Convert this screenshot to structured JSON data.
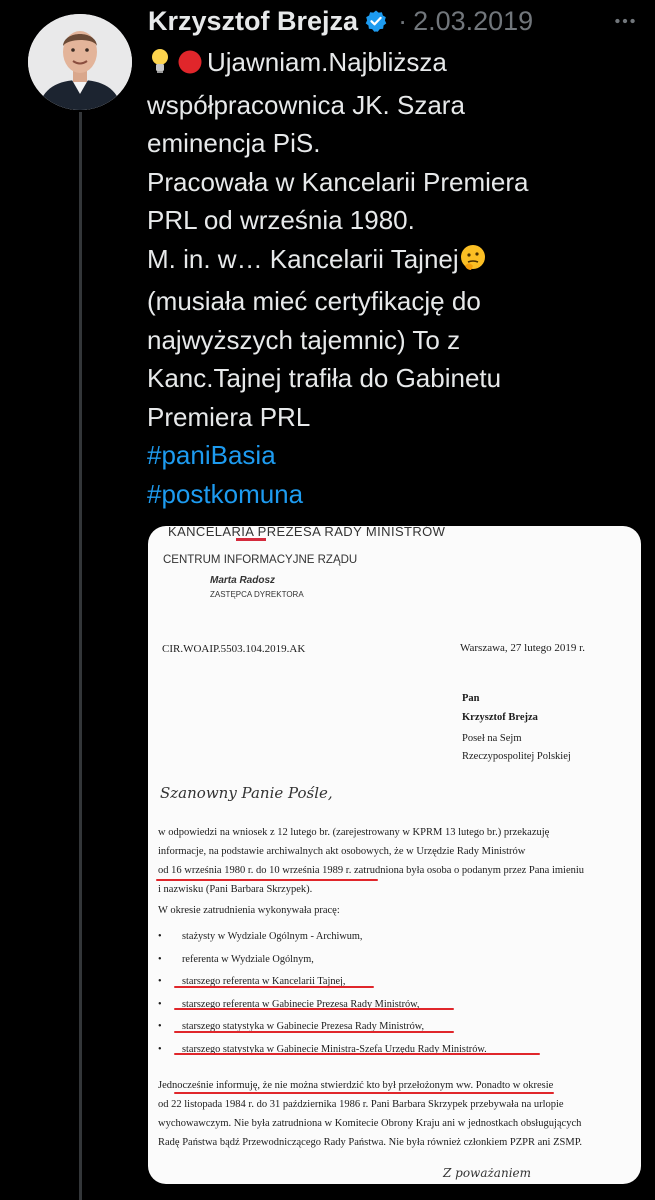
{
  "tweet": {
    "author": "Krzysztof Brejza",
    "separator": "·",
    "date": "2.03.2019",
    "text_lines": [
      {
        "emoji": [
          "lightbulb",
          "red-circle"
        ],
        "text": "Ujawniam.Najbliższa"
      },
      {
        "text": "współpracownica JK. Szara"
      },
      {
        "text": "eminencja PiS."
      },
      {
        "text": "Pracowała w Kancelarii Premiera"
      },
      {
        "text": "PRL od września 1980."
      },
      {
        "text": "M. in. w… Kancelarii Tajnej",
        "emoji_after": "thinking-face"
      },
      {
        "text": "(musiała mieć certyfikację do"
      },
      {
        "text": "najwyższych tajemnic) To z"
      },
      {
        "text": "Kanc.Tajnej trafiła do Gabinetu"
      },
      {
        "text": "Premiera PRL"
      }
    ],
    "hashtags": [
      "#paniBasia",
      "#postkomuna"
    ],
    "colors": {
      "hashtag": "#1d9bf0",
      "verified": "#1d9bf0",
      "underline": "#e0262b"
    }
  },
  "document": {
    "org": "KANCELARIA PREZESA RADY MINISTRÓW",
    "dept": "CENTRUM INFORMACYJNE RZĄDU",
    "signer_name": "Marta Radosz",
    "signer_role": "ZASTĘPCA DYREKTORA",
    "ref": "CIR.WOAIP.5503.104.2019.AK",
    "place_date": "Warszawa, 27 lutego 2019 r.",
    "addressee": [
      "Pan",
      "Krzysztof Brejza",
      "Poseł na Sejm",
      "Rzeczypospolitej Polskiej"
    ],
    "greeting": "Szanowny Panie Pośle,",
    "para1": [
      "w odpowiedzi na wniosek z 12 lutego br. (zarejestrowany w KPRM 13 lutego br.) przekazuję",
      "informacje, na podstawie archiwalnych akt osobowych, że w Urzędzie Rady Ministrów",
      "od 16 września 1980 r. do 10 września 1989 r. zatrudniona była osoba o podanym przez Pana imieniu",
      "i nazwisku (Pani Barbara Skrzypek)."
    ],
    "para2_intro": "W okresie zatrudnienia wykonywała pracę:",
    "jobs": [
      "stażysty w Wydziale Ogólnym - Archiwum,",
      "referenta w Wydziale Ogólnym,",
      "starszego referenta w Kancelarii Tajnej,",
      "starszego referenta w Gabinecie Prezesa Rady Ministrów,",
      "starszego statystyka w Gabinecie Prezesa Rady Ministrów,",
      "starszego statystyka w Gabinecie Ministra-Szefa Urzędu Rady Ministrów."
    ],
    "bullet": "•",
    "para3": [
      "Jednocześnie informuję, że nie można stwierdzić kto był przełożonym ww. Ponadto w okresie",
      "od 22 listopada 1984 r. do 31 października 1986 r. Pani Barbara Skrzypek przebywała na urlopie",
      "wychowawczym. Nie była zatrudniona w Komitecie Obrony Kraju ani w jednostkach obsługujących",
      "Radę Państwa bądź Przewodniczącego Rady Państwa. Nie była również członkiem PZPR ani ZSMP."
    ],
    "closing": "Z poważaniem"
  }
}
